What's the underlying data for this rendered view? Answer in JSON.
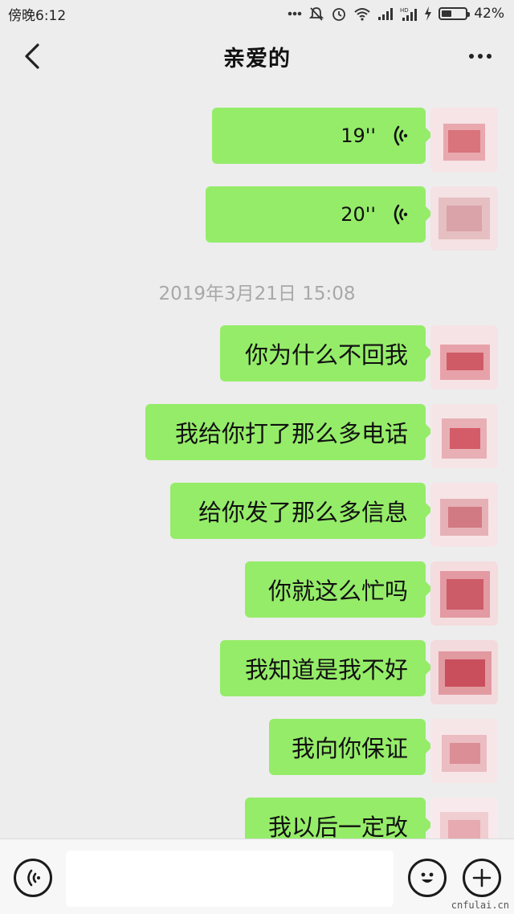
{
  "status_bar": {
    "time": "傍晚6:12",
    "battery_percent": "42%",
    "battery_level": 0.42,
    "icons": [
      "more-dots-icon",
      "mute-icon",
      "alarm-icon",
      "wifi-icon",
      "signal-icon",
      "hd-signal-icon",
      "charging-icon",
      "battery-icon"
    ]
  },
  "nav": {
    "title": "亲爱的",
    "back_icon": "chevron-left-icon",
    "more_icon": "more-icon"
  },
  "chat": {
    "voice_messages": [
      {
        "duration": "19''"
      },
      {
        "duration": "20''"
      }
    ],
    "timestamp": "2019年3月21日 15:08",
    "text_messages": [
      {
        "text": "你为什么不回我"
      },
      {
        "text": "我给你打了那么多电话"
      },
      {
        "text": "给你发了那么多信息"
      },
      {
        "text": "你就这么忙吗"
      },
      {
        "text": "我知道是我不好"
      },
      {
        "text": "我向你保证"
      },
      {
        "text": "我以后一定改"
      }
    ],
    "bubble_color": "#95EC69"
  },
  "input_bar": {
    "voice_icon": "voice-input-icon",
    "emoji_icon": "emoji-icon",
    "plus_icon": "plus-icon"
  },
  "watermark": "cnfulai.cn"
}
